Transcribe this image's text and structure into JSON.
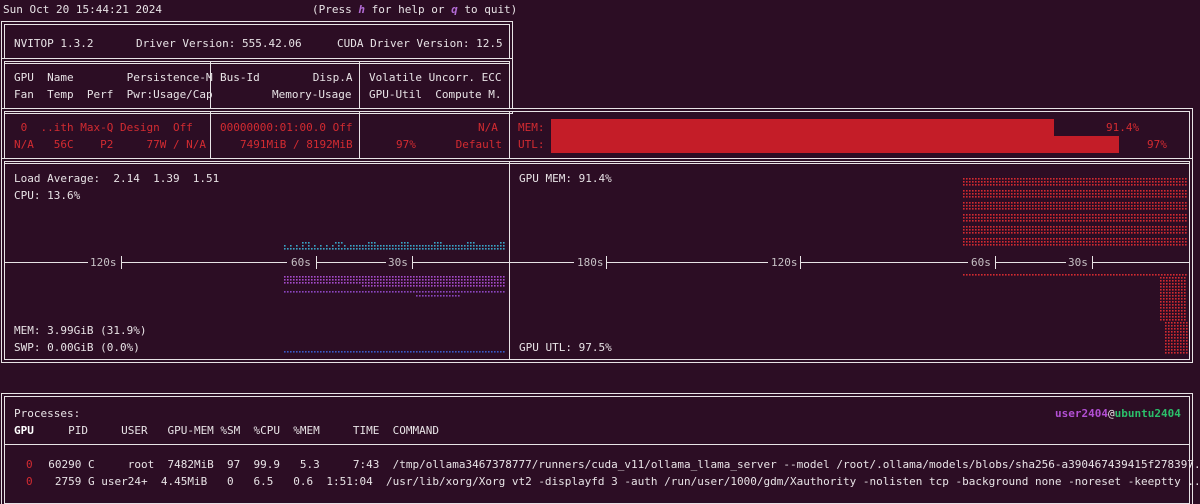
{
  "header": {
    "datetime": "Sun Oct 20 15:44:21 2024",
    "help_prefix": "(Press ",
    "help_key": "h",
    "help_mid": " for help or ",
    "quit_key": "q",
    "help_suffix": " to quit)"
  },
  "summary": {
    "version": "NVITOP 1.3.2",
    "driver": "Driver Version: 555.42.06",
    "cuda": "CUDA Driver Version: 12.5"
  },
  "columns": {
    "c1_row1": "GPU  Name        Persistence-M",
    "c1_row2": "Fan  Temp  Perf  Pwr:Usage/Cap",
    "c2_row1": "Bus-Id        Disp.A",
    "c2_row2": "Memory-Usage",
    "c3_row1": "Volatile Uncorr. ECC",
    "c3_row2": "GPU-Util  Compute M."
  },
  "gpu": {
    "row1_c1": " 0  ..ith Max-Q Design  Off",
    "row2_c1": "N/A   56C    P2     77W / N/A",
    "row1_c2": "00000000:01:00.0 Off",
    "row2_c2": "7491MiB / 8192MiB",
    "row1_c3": "N/A",
    "row2_c3": "97%      Default",
    "mem_label": "MEM:",
    "mem_value": "91.4%",
    "mem_fraction": 0.914,
    "utl_label": "UTL:",
    "utl_value": "97%",
    "utl_fraction": 0.97
  },
  "host": {
    "load_average": "Load Average:  2.14  1.39  1.51",
    "cpu": "CPU: 13.6%",
    "mem": "MEM: 3.99GiB (31.9%)",
    "swp": "SWP: 0.00GiB (0.0%)",
    "gpu_mem": "GPU MEM: 91.4%",
    "gpu_utl": "GPU UTL: 97.5%",
    "left_axis": [
      "120s",
      "60s",
      "30s"
    ],
    "right_axis": [
      "180s",
      "120s",
      "60s",
      "30s"
    ]
  },
  "processes": {
    "title": "Processes:",
    "user": "user2404",
    "at": "@",
    "host": "ubuntu2404",
    "headers": {
      "gpu": "GPU",
      "rest": "     PID     USER   GPU-MEM %SM  %CPU  %MEM     TIME  COMMAND"
    },
    "rows": [
      {
        "gpu": "0",
        "rest": "  60290 C     root  7482MiB  97  99.9   5.3     7:43  /tmp/ollama3467378777/runners/cuda_v11/ollama_llama_server --model /root/.ollama/models/blobs/sha256-a390467439415f278397.."
      },
      {
        "gpu": "0",
        "rest": "   2759 G user24+  4.45MiB   0   6.5   0.6  1:51:04  /usr/lib/xorg/Xorg vt2 -displayfd 3 -auth /run/user/1000/gdm/Xauthority -nolisten tcp -background none -noreset -keeptty .."
      }
    ]
  }
}
